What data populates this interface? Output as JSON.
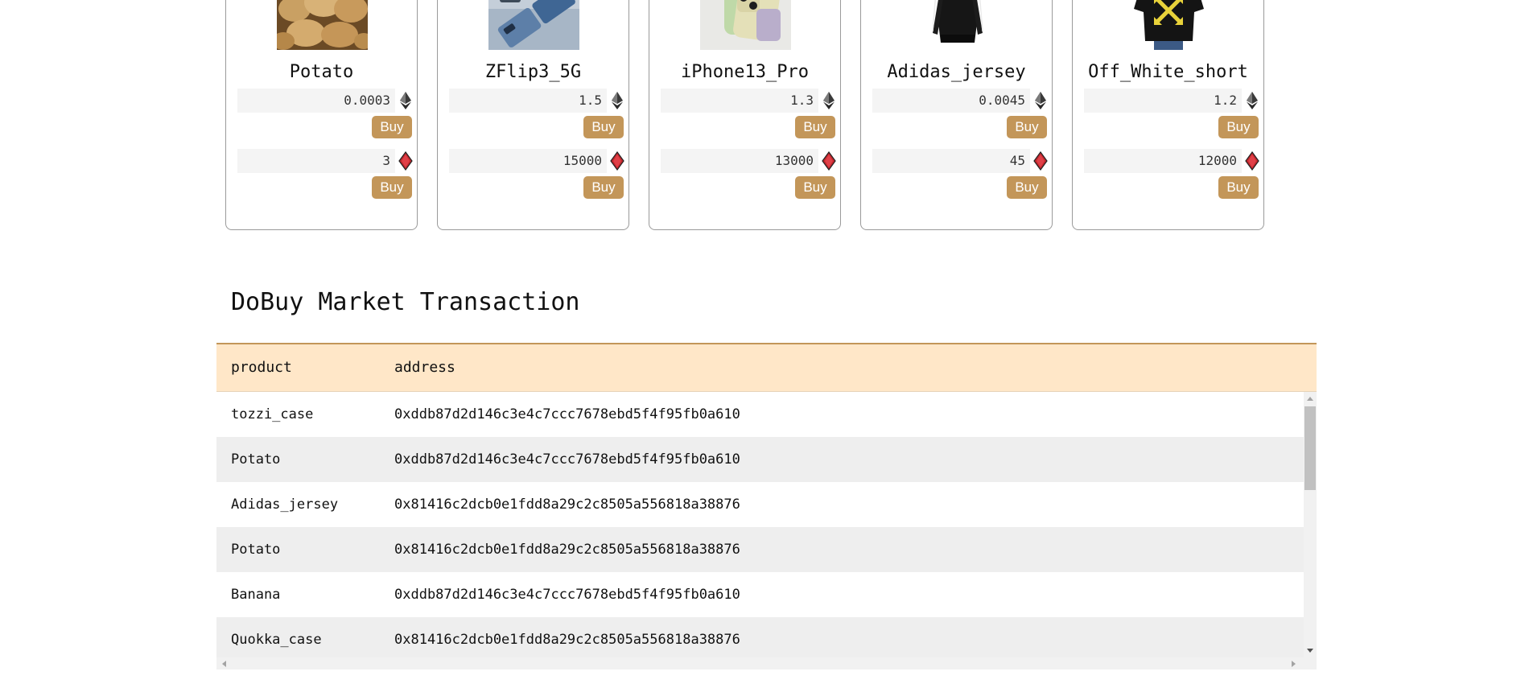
{
  "colors": {
    "accent": "#c39659",
    "table_header_bg": "#ffe7c8",
    "eth_icon": "#2b2b2b",
    "ruby_icon": "#c0272d"
  },
  "products": [
    {
      "name": "Potato",
      "eth_price": "0.0003",
      "token_price": "3",
      "buy_label": "Buy",
      "image": "potato-photo"
    },
    {
      "name": "ZFlip3_5G",
      "eth_price": "1.5",
      "token_price": "15000",
      "buy_label": "Buy",
      "image": "phone-photo"
    },
    {
      "name": "iPhone13_Pro",
      "eth_price": "1.3",
      "token_price": "13000",
      "buy_label": "Buy",
      "image": "iphone-photo"
    },
    {
      "name": "Adidas_jersey",
      "eth_price": "0.0045",
      "token_price": "45",
      "buy_label": "Buy",
      "image": "jersey-photo"
    },
    {
      "name": "Off_White_short",
      "eth_price": "1.2",
      "token_price": "12000",
      "buy_label": "Buy",
      "image": "tshirt-photo"
    }
  ],
  "transactions": {
    "title": "DoBuy Market Transaction",
    "columns": [
      "product",
      "address"
    ],
    "rows": [
      {
        "product": "tozzi_case",
        "address": "0xddb87d2d146c3e4c7ccc7678ebd5f4f95fb0a610"
      },
      {
        "product": "Potato",
        "address": "0xddb87d2d146c3e4c7ccc7678ebd5f4f95fb0a610"
      },
      {
        "product": "Adidas_jersey",
        "address": "0x81416c2dcb0e1fdd8a29c2c8505a556818a38876"
      },
      {
        "product": "Potato",
        "address": "0x81416c2dcb0e1fdd8a29c2c8505a556818a38876"
      },
      {
        "product": "Banana",
        "address": "0xddb87d2d146c3e4c7ccc7678ebd5f4f95fb0a610"
      },
      {
        "product": "Quokka_case",
        "address": "0x81416c2dcb0e1fdd8a29c2c8505a556818a38876"
      }
    ]
  }
}
